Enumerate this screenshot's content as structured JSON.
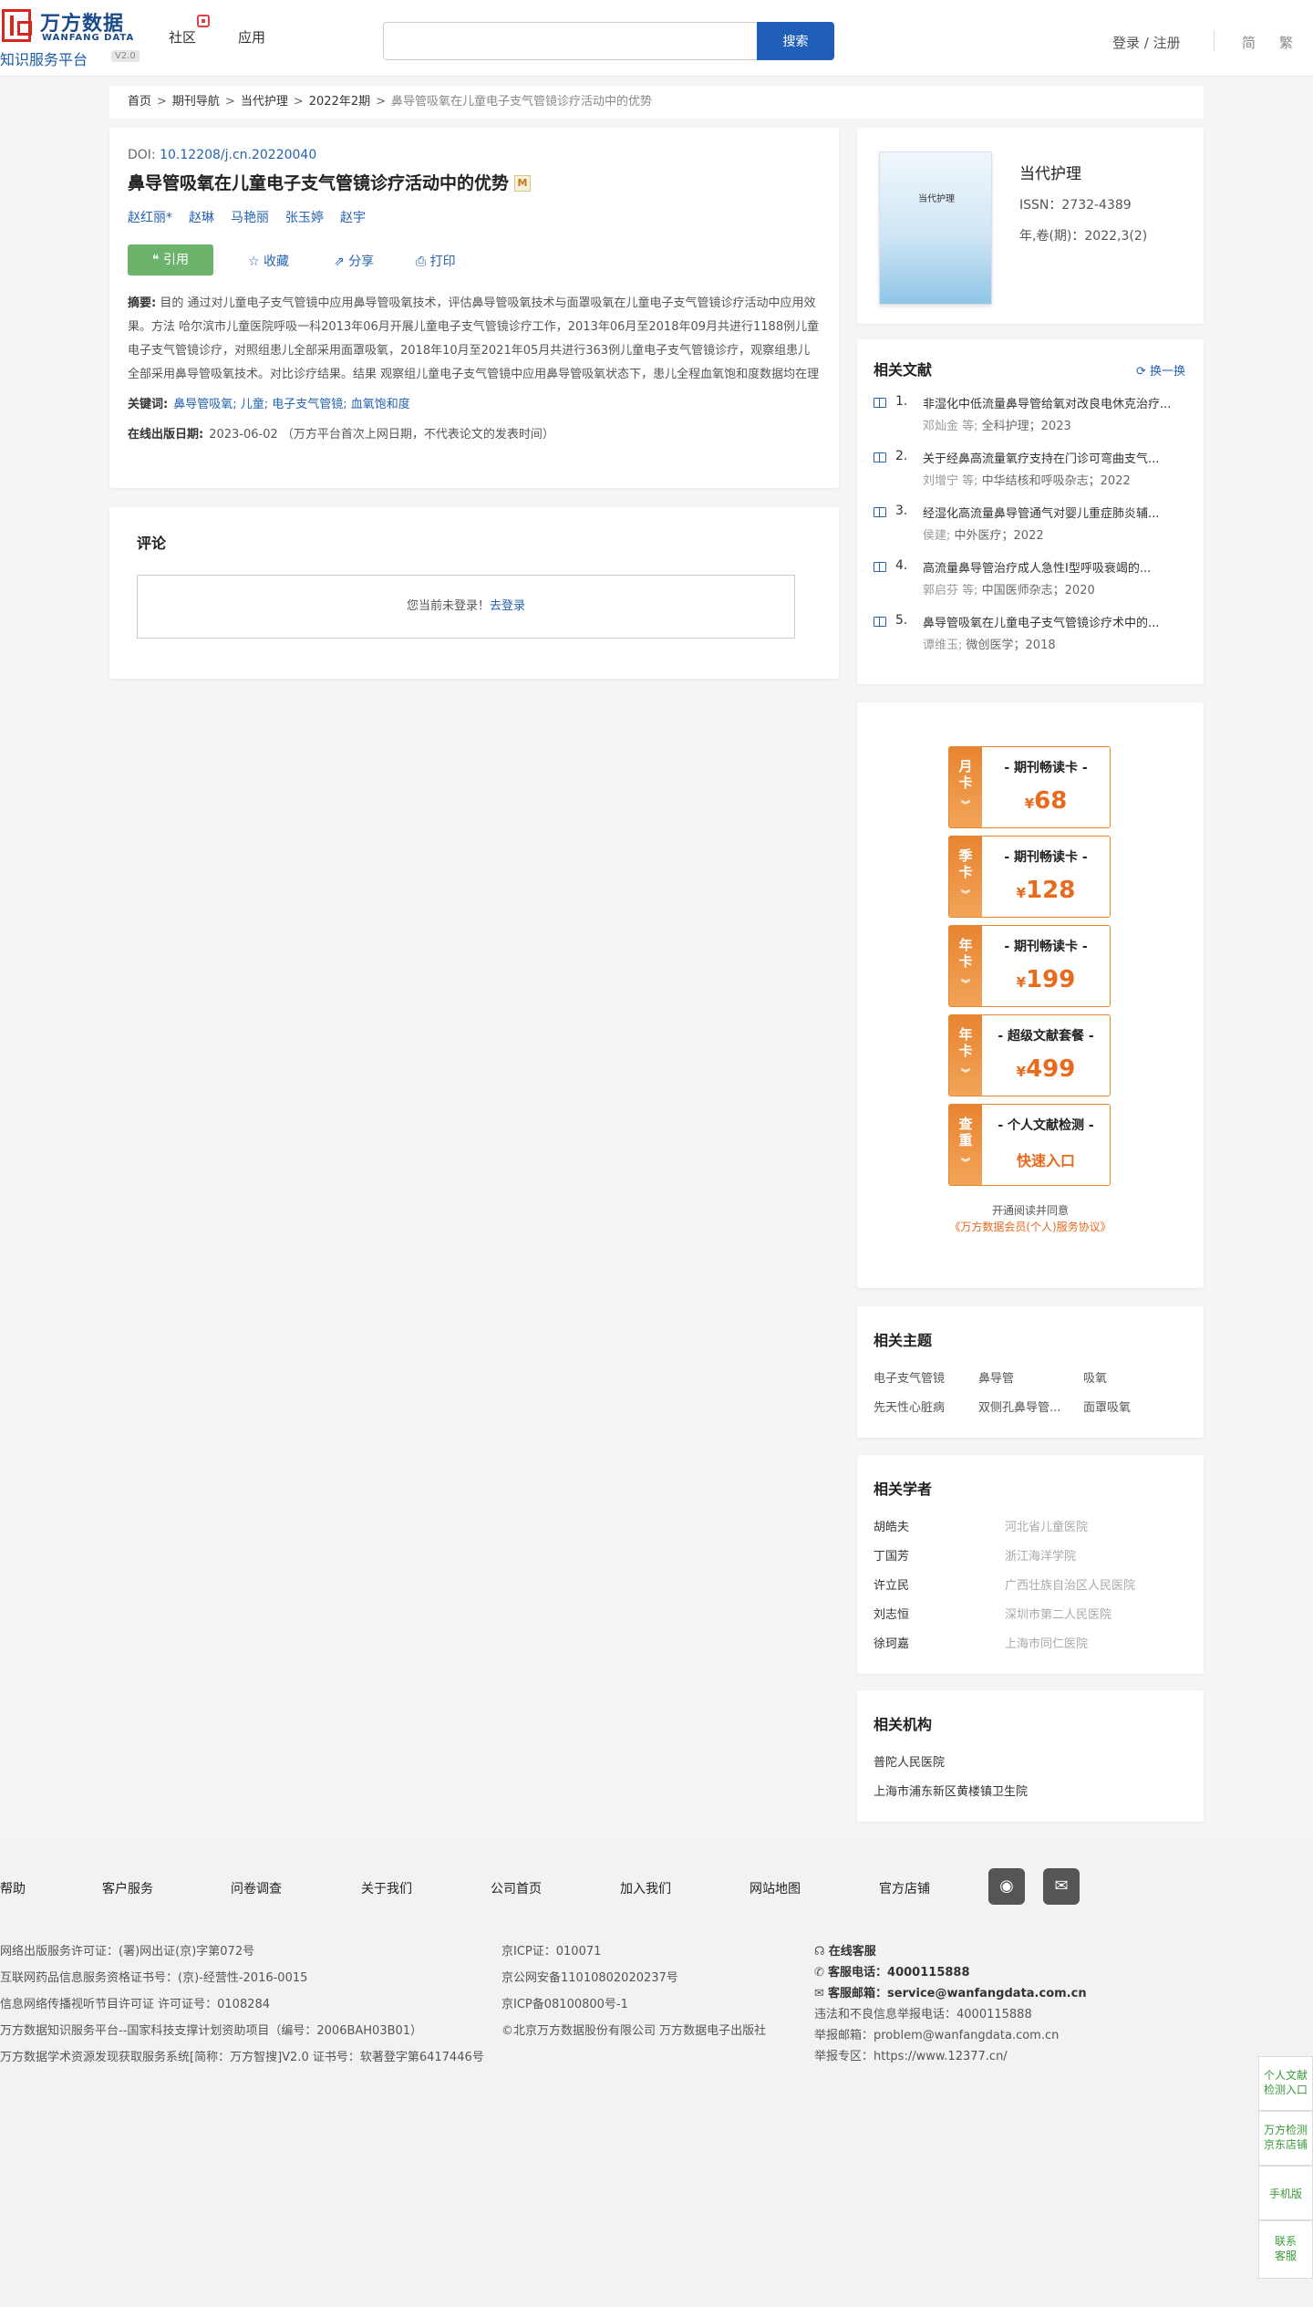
{
  "header": {
    "logo_cn": "万方数据",
    "logo_en": "WANFANG DATA",
    "logo_sub": "知识服务平台",
    "logo_ver": "V2.0",
    "nav": [
      "社区",
      "应用"
    ],
    "search_btn": "搜索",
    "search_placeholder": "",
    "login": "登录 / 注册",
    "lang_simplified": "简",
    "lang_traditional": "繁"
  },
  "breadcrumb": [
    "首页",
    "期刊导航",
    "当代护理",
    "2022年2期",
    "鼻导管吸氧在儿童电子支气管镜诊疗活动中的优势"
  ],
  "article": {
    "doi_label": "DOI:",
    "doi_value": "10.12208/j.cn.20220040",
    "title": "鼻导管吸氧在儿童电子支气管镜诊疗活动中的优势",
    "m_badge": "M",
    "authors": [
      "赵红丽*",
      "赵琳",
      "马艳丽",
      "张玉婷",
      "赵宇"
    ],
    "cite": "引用",
    "collect": "收藏",
    "share": "分享",
    "print": "打印",
    "abstract_label": "摘要:",
    "abstract_text": "目的 通过对儿童电子支气管镜中应用鼻导管吸氧技术，评估鼻导管吸氧技术与面罩吸氧在儿童电子支气管镜诊疗活动中应用效果。方法 哈尔滨市儿童医院呼吸一科2013年06月开展儿童电子支气管镜诊疗工作，2013年06月至2018年09月共进行1188例儿童电子支气管镜诊疗，对照组患儿全部采用面罩吸氧，2018年10月至2021年05月共进行363例儿童电子支气管镜诊疗，观察组患儿全部采用鼻导管吸氧技术。对比诊疗结果。结果 观察组儿童电子支气管镜中应用鼻导管吸氧状态下，患儿全程血氧饱和度数据均在理想水平，受到临床医生认可及护士的好评。结论 鼻导管吸氧技术在儿童电子支管...",
    "keywords_label": "关键词:",
    "keywords": "鼻导管吸氧; 儿童; 电子支气管镜; 血氧饱和度",
    "pubdate_label": "在线出版日期:",
    "pubdate_value": "2023-06-02 （万方平台首次上网日期，不代表论文的发表时间）"
  },
  "comments": {
    "title": "评论",
    "not_logged": "您当前未登录！",
    "go_login": "去登录"
  },
  "journal": {
    "cover_text": "当代护理",
    "name": "当代护理",
    "issn": "ISSN：2732-4389",
    "year_vol": "年,卷(期)：2022,3(2)"
  },
  "related_docs": {
    "title": "相关文献",
    "swap": "换一换",
    "items": [
      {
        "num": "1.",
        "title": "非湿化中低流量鼻导管给氧对改良电休克治疗...",
        "meta_a": "邓灿金 等;",
        "meta_b": "全科护理；2023"
      },
      {
        "num": "2.",
        "title": "关于经鼻高流量氧疗支持在门诊可弯曲支气...",
        "meta_a": "刘增宁 等;",
        "meta_b": "中华结核和呼吸杂志；2022"
      },
      {
        "num": "3.",
        "title": "经湿化高流量鼻导管通气对婴儿重症肺炎辅...",
        "meta_a": "侯建;",
        "meta_b": "中外医疗；2022"
      },
      {
        "num": "4.",
        "title": "高流量鼻导管治疗成人急性Ⅰ型呼吸衰竭的...",
        "meta_a": "郭启芬 等;",
        "meta_b": "中国医师杂志；2020"
      },
      {
        "num": "5.",
        "title": "鼻导管吸氧在儿童电子支气管镜诊疗术中的...",
        "meta_a": "谭维玉;",
        "meta_b": "微创医学；2018"
      }
    ]
  },
  "promo": {
    "cards": [
      {
        "side": [
          "月",
          "卡"
        ],
        "title": "- 期刊畅读卡 -",
        "currency": "¥",
        "price": "68"
      },
      {
        "side": [
          "季",
          "卡"
        ],
        "title": "- 期刊畅读卡 -",
        "currency": "¥",
        "price": "128"
      },
      {
        "side": [
          "年",
          "卡"
        ],
        "title": "- 期刊畅读卡 -",
        "currency": "¥",
        "price": "199"
      },
      {
        "side": [
          "年",
          "卡"
        ],
        "title": "- 超级文献套餐 -",
        "currency": "¥",
        "price": "499"
      },
      {
        "side": [
          "查",
          "重"
        ],
        "title": "- 个人文献检测 -",
        "quick": "快速入口"
      }
    ],
    "agree_text": "开通阅读并同意",
    "agree_link": "《万方数据会员(个人)服务协议》",
    "accent": "#e86a1c"
  },
  "topics": {
    "title": "相关主题",
    "items": [
      "电子支气管镜",
      "鼻导管",
      "吸氧",
      "先天性心脏病",
      "双侧孔鼻导管...",
      "面罩吸氧"
    ]
  },
  "scholars": {
    "title": "相关学者",
    "items": [
      {
        "name": "胡皓夫",
        "org": "河北省儿童医院"
      },
      {
        "name": "丁国芳",
        "org": "浙江海洋学院"
      },
      {
        "name": "许立民",
        "org": "广西壮族自治区人民医院"
      },
      {
        "name": "刘志恒",
        "org": "深圳市第二人民医院"
      },
      {
        "name": "徐珂嘉",
        "org": "上海市同仁医院"
      }
    ]
  },
  "orgs": {
    "title": "相关机构",
    "items": [
      "普陀人民医院",
      "上海市浦东新区黄楼镇卫生院"
    ]
  },
  "footer": {
    "nav": [
      "帮助",
      "客户服务",
      "问卷调查",
      "关于我们",
      "公司首页",
      "加入我们",
      "网站地图",
      "官方店铺"
    ],
    "col1": [
      "网络出版服务许可证：(署)网出证(京)字第072号",
      "互联网药品信息服务资格证书号：(京)-经营性-2016-0015",
      "信息网络传播视听节目许可证 许可证号：0108284",
      "万方数据知识服务平台--国家科技支撑计划资助项目（编号：2006BAH03B01）",
      "万方数据学术资源发现获取服务系统[简称：万方智搜]V2.0 证书号：软著登字第6417446号"
    ],
    "col2": [
      "京ICP证：010071",
      "京公网安备11010802020237号",
      "京ICP备08100800号-1",
      "©北京万方数据股份有限公司 万方数据电子出版社"
    ],
    "col3": {
      "online": "在线客服",
      "phone_label": "客服电话：",
      "phone": "4000115888",
      "email_label": "客服邮箱：",
      "email": "service@wanfangdata.com.cn",
      "report_phone": "违法和不良信息举报电话：4000115888",
      "report_email": "举报邮箱：problem@wanfangdata.com.cn",
      "report_site": "举报专区：https://www.12377.cn/"
    }
  },
  "float": {
    "items": [
      [
        "个人文献",
        "检测入口"
      ],
      [
        "万方检测",
        "京东店铺"
      ],
      [
        "手机版"
      ],
      [
        "联系",
        "客服"
      ]
    ]
  }
}
